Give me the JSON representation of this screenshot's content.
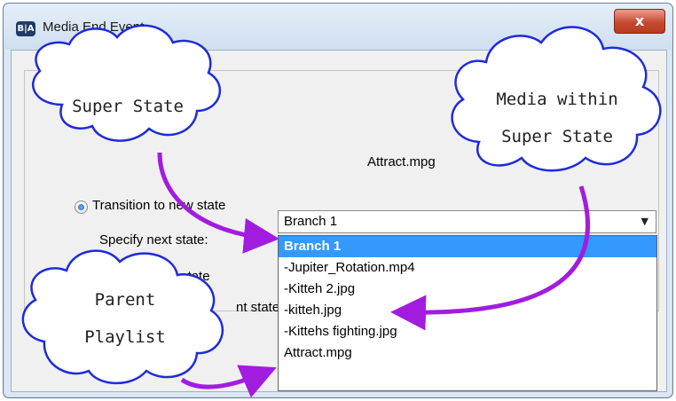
{
  "window": {
    "title": "Media End Event",
    "app_icon_text": "B|A",
    "close_symbol": "x"
  },
  "dialog": {
    "media_file": "Attract.mpg",
    "option_transition": "Transition to new state",
    "specify_next_label": "Specify next state:",
    "option_return": "Return to prior state",
    "option_parent_partial": "nt state",
    "next_state_selected": "Branch 1",
    "dropdown_items": [
      "Branch 1",
      "-Jupiter_Rotation.mp4",
      "-Kitteh 2.jpg",
      "-kitteh.jpg",
      "-Kittehs fighting.jpg",
      "Attract.mpg"
    ]
  },
  "annotations": {
    "super_state": "Super State",
    "media_within_line1": "Media within",
    "media_within_line2": "Super State",
    "parent_playlist_line1": "Parent",
    "parent_playlist_line2": "Playlist"
  },
  "colors": {
    "selection": "#3399ff",
    "arrow": "#a21ce0",
    "cloud_fill": "#ffffff",
    "cloud_stroke": "#1f2bd8"
  }
}
